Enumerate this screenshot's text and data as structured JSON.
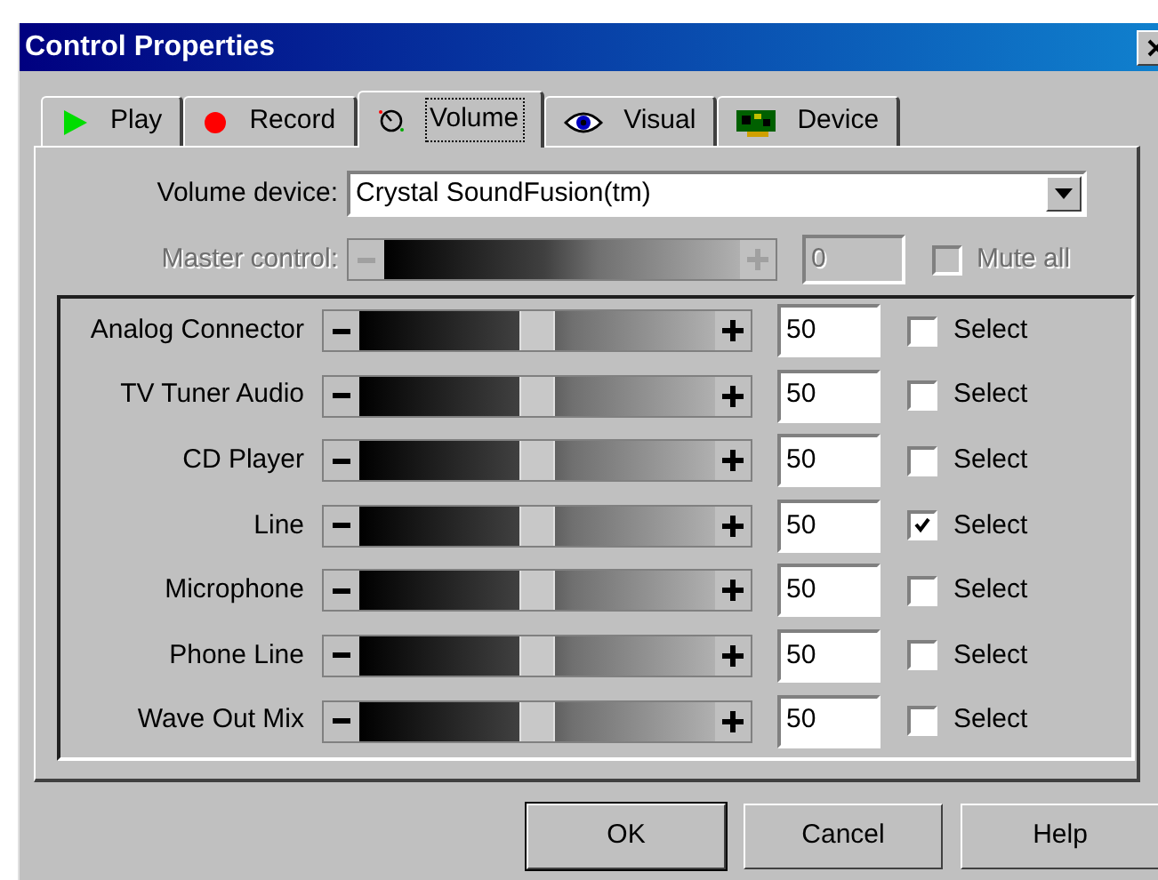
{
  "window": {
    "title": "Control Properties"
  },
  "tabs": [
    {
      "label": "Play",
      "kind": "play",
      "selected": false
    },
    {
      "label": "Record",
      "kind": "record",
      "selected": false
    },
    {
      "label": "Volume",
      "kind": "volume",
      "selected": true
    },
    {
      "label": "Visual",
      "kind": "visual",
      "selected": false
    },
    {
      "label": "Device",
      "kind": "device",
      "selected": false
    }
  ],
  "volume_device": {
    "label": "Volume device:",
    "value": "Crystal SoundFusion(tm)"
  },
  "master": {
    "label": "Master control:",
    "value": "0",
    "mute_label": "Mute all",
    "disabled": true,
    "checked": false
  },
  "channels": [
    {
      "name": "Analog Connector",
      "level": 0.5,
      "value": "50",
      "select_label": "Select",
      "checked": false
    },
    {
      "name": "TV Tuner Audio",
      "level": 0.5,
      "value": "50",
      "select_label": "Select",
      "checked": false
    },
    {
      "name": "CD Player",
      "level": 0.5,
      "value": "50",
      "select_label": "Select",
      "checked": false
    },
    {
      "name": "Line",
      "level": 0.5,
      "value": "50",
      "select_label": "Select",
      "checked": true
    },
    {
      "name": "Microphone",
      "level": 0.5,
      "value": "50",
      "select_label": "Select",
      "checked": false
    },
    {
      "name": "Phone Line",
      "level": 0.5,
      "value": "50",
      "select_label": "Select",
      "checked": false
    },
    {
      "name": "Wave Out Mix",
      "level": 0.5,
      "value": "50",
      "select_label": "Select",
      "checked": false
    }
  ],
  "buttons": [
    "OK",
    "Cancel",
    "Help"
  ]
}
